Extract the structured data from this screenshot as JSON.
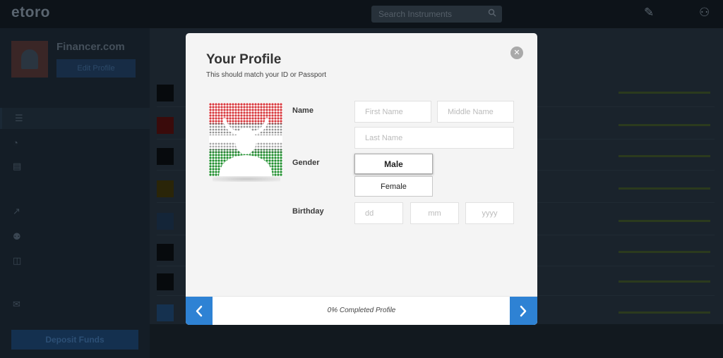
{
  "app": {
    "logo": "etoro",
    "search_placeholder": "Search Instruments",
    "user_name": "Financer.com",
    "edit_profile_label": "Edit Profile",
    "deposit_label": "Deposit Funds"
  },
  "modal": {
    "title": "Your Profile",
    "subtitle": "This should match your ID or Passport",
    "close_icon": "close-icon",
    "labels": {
      "name": "Name",
      "gender": "Gender",
      "birthday": "Birthday"
    },
    "fields": {
      "first_name_placeholder": "First Name",
      "first_name_value": "",
      "middle_name_placeholder": "Middle Name",
      "middle_name_value": "",
      "last_name_placeholder": "Last Name",
      "last_name_value": "",
      "day_placeholder": "dd",
      "day_value": "",
      "month_placeholder": "mm",
      "month_value": "",
      "year_placeholder": "yyyy",
      "year_value": ""
    },
    "gender_options": [
      {
        "label": "Male",
        "selected": true
      },
      {
        "label": "Female",
        "selected": false
      }
    ],
    "progress_text": "0% Completed Profile",
    "prev_icon": "chevron-left-icon",
    "next_icon": "chevron-right-icon"
  },
  "colors": {
    "accent": "#2e82d4",
    "modal_bg": "#f4f4f4",
    "overlay_bg": "#121a22"
  }
}
